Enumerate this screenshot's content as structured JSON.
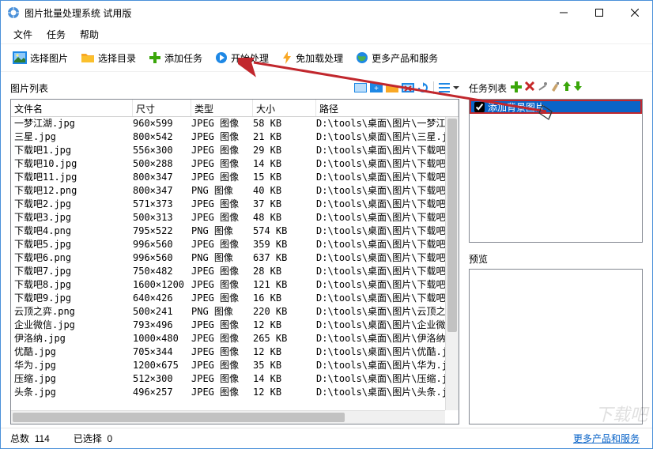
{
  "title": "图片批量处理系统 试用版",
  "menu": {
    "file": "文件",
    "task": "任务",
    "help": "帮助"
  },
  "toolbar": {
    "select_images": "选择图片",
    "select_folder": "选择目录",
    "add_task": "添加任务",
    "start_process": "开始处理",
    "fast_process": "免加载处理",
    "more_products": "更多产品和服务"
  },
  "left_panel_title": "图片列表",
  "columns": {
    "name": "文件名",
    "size": "尺寸",
    "type": "类型",
    "filesize": "大小",
    "path": "路径"
  },
  "rows": [
    {
      "name": "一梦江湖.jpg",
      "size": "960×599",
      "type": "JPEG 图像",
      "fsize": "58 KB",
      "path": "D:\\tools\\桌面\\图片\\一梦江"
    },
    {
      "name": "三星.jpg",
      "size": "800×542",
      "type": "JPEG 图像",
      "fsize": "21 KB",
      "path": "D:\\tools\\桌面\\图片\\三星.j"
    },
    {
      "name": "下载吧1.jpg",
      "size": "556×300",
      "type": "JPEG 图像",
      "fsize": "29 KB",
      "path": "D:\\tools\\桌面\\图片\\下载吧"
    },
    {
      "name": "下载吧10.jpg",
      "size": "500×288",
      "type": "JPEG 图像",
      "fsize": "14 KB",
      "path": "D:\\tools\\桌面\\图片\\下载吧"
    },
    {
      "name": "下载吧11.jpg",
      "size": "800×347",
      "type": "JPEG 图像",
      "fsize": "15 KB",
      "path": "D:\\tools\\桌面\\图片\\下载吧"
    },
    {
      "name": "下载吧12.png",
      "size": "800×347",
      "type": "PNG 图像",
      "fsize": "40 KB",
      "path": "D:\\tools\\桌面\\图片\\下载吧"
    },
    {
      "name": "下载吧2.jpg",
      "size": "571×373",
      "type": "JPEG 图像",
      "fsize": "37 KB",
      "path": "D:\\tools\\桌面\\图片\\下载吧"
    },
    {
      "name": "下载吧3.jpg",
      "size": "500×313",
      "type": "JPEG 图像",
      "fsize": "48 KB",
      "path": "D:\\tools\\桌面\\图片\\下载吧"
    },
    {
      "name": "下载吧4.png",
      "size": "795×522",
      "type": "PNG 图像",
      "fsize": "574 KB",
      "path": "D:\\tools\\桌面\\图片\\下载吧"
    },
    {
      "name": "下载吧5.jpg",
      "size": "996×560",
      "type": "JPEG 图像",
      "fsize": "359 KB",
      "path": "D:\\tools\\桌面\\图片\\下载吧"
    },
    {
      "name": "下载吧6.png",
      "size": "996×560",
      "type": "PNG 图像",
      "fsize": "637 KB",
      "path": "D:\\tools\\桌面\\图片\\下载吧"
    },
    {
      "name": "下载吧7.jpg",
      "size": "750×482",
      "type": "JPEG 图像",
      "fsize": "28 KB",
      "path": "D:\\tools\\桌面\\图片\\下载吧"
    },
    {
      "name": "下载吧8.jpg",
      "size": "1600×1200",
      "type": "JPEG 图像",
      "fsize": "121 KB",
      "path": "D:\\tools\\桌面\\图片\\下载吧"
    },
    {
      "name": "下载吧9.jpg",
      "size": "640×426",
      "type": "JPEG 图像",
      "fsize": "16 KB",
      "path": "D:\\tools\\桌面\\图片\\下载吧"
    },
    {
      "name": "云顶之弈.png",
      "size": "500×241",
      "type": "PNG 图像",
      "fsize": "220 KB",
      "path": "D:\\tools\\桌面\\图片\\云顶之"
    },
    {
      "name": "企业微信.jpg",
      "size": "793×496",
      "type": "JPEG 图像",
      "fsize": "12 KB",
      "path": "D:\\tools\\桌面\\图片\\企业微"
    },
    {
      "name": "伊洛纳.jpg",
      "size": "1000×480",
      "type": "JPEG 图像",
      "fsize": "265 KB",
      "path": "D:\\tools\\桌面\\图片\\伊洛纳"
    },
    {
      "name": "优酷.jpg",
      "size": "705×344",
      "type": "JPEG 图像",
      "fsize": "12 KB",
      "path": "D:\\tools\\桌面\\图片\\优酷.j"
    },
    {
      "name": "华为.jpg",
      "size": "1200×675",
      "type": "JPEG 图像",
      "fsize": "35 KB",
      "path": "D:\\tools\\桌面\\图片\\华为.j"
    },
    {
      "name": "压缩.jpg",
      "size": "512×300",
      "type": "JPEG 图像",
      "fsize": "14 KB",
      "path": "D:\\tools\\桌面\\图片\\压缩.j"
    },
    {
      "name": "头条.jpg",
      "size": "496×257",
      "type": "JPEG 图像",
      "fsize": "12 KB",
      "path": "D:\\tools\\桌面\\图片\\头条.j"
    }
  ],
  "task_panel_title": "任务列表",
  "task_item": "添加背景图片",
  "preview_label": "预览",
  "status": {
    "total_label": "总数",
    "total_value": "114",
    "selected_label": "已选择",
    "selected_value": "0"
  },
  "more_link": "更多产品和服务",
  "watermark": "下载吧"
}
